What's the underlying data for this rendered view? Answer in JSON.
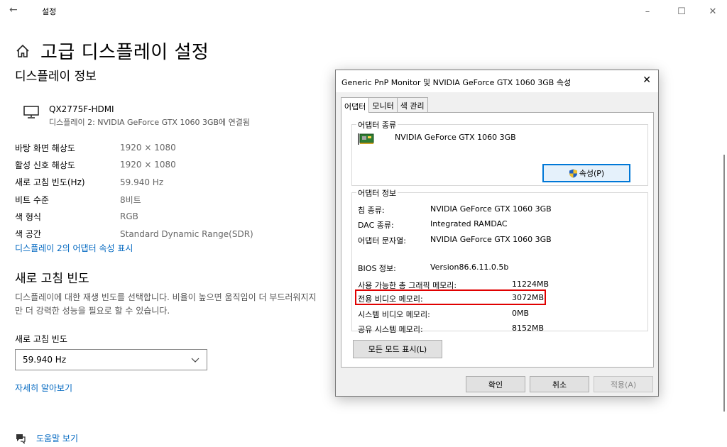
{
  "window": {
    "title": "설정",
    "back_icon": "←",
    "min_icon": "–",
    "max_icon": "☐",
    "close_icon": "✕"
  },
  "page": {
    "title": "고급 디스플레이 설정"
  },
  "display_info": {
    "section_title": "디스플레이 정보",
    "monitor_name": "QX2775F-HDMI",
    "monitor_connection": "디스플레이 2: NVIDIA GeForce GTX 1060 3GB에 연결됨",
    "rows": [
      {
        "label": "바탕 화면 해상도",
        "value": "1920 × 1080"
      },
      {
        "label": "활성 신호 해상도",
        "value": "1920 × 1080"
      },
      {
        "label": "새로 고침 빈도(Hz)",
        "value": "59.940 Hz"
      },
      {
        "label": "비트 수준",
        "value": "8비트"
      },
      {
        "label": "색 형식",
        "value": "RGB"
      },
      {
        "label": "색 공간",
        "value": "Standard Dynamic Range(SDR)"
      }
    ],
    "adapter_link": "디스플레이 2의 어댑터 속성 표시"
  },
  "refresh": {
    "section_title": "새로 고침 빈도",
    "description": "디스플레이에 대한 재생 빈도를 선택합니다. 비율이 높으면 움직임이 더 부드러워지지만 더 강력한 성능을 필요로 할 수 있습니다.",
    "select_label": "새로 고침 빈도",
    "select_value": "59.940 Hz",
    "more_link": "자세히 알아보기"
  },
  "help": {
    "label": "도움말 보기"
  },
  "dialog": {
    "title": "Generic PnP Monitor 및 NVIDIA GeForce GTX 1060 3GB 속성",
    "close_icon": "✕",
    "tabs": [
      {
        "label": "어댑터"
      },
      {
        "label": "모니터"
      },
      {
        "label": "색 관리"
      }
    ],
    "adapter_type_legend": "어댑터 종류",
    "adapter_name": "NVIDIA GeForce GTX 1060 3GB",
    "properties_button": "속성(P)",
    "adapter_info_legend": "어댑터 정보",
    "info_rows": [
      {
        "label": "칩 종류:",
        "value": "NVIDIA GeForce GTX 1060 3GB"
      },
      {
        "label": "DAC 종류:",
        "value": "Integrated RAMDAC"
      },
      {
        "label": "어댑터 문자열:",
        "value": "NVIDIA GeForce GTX 1060 3GB"
      },
      {
        "label": "BIOS 정보:",
        "value": "Version86.6.11.0.5b"
      }
    ],
    "memory_rows": [
      {
        "label": "사용 가능한 총 그래픽 메모리:",
        "value": "11224MB"
      },
      {
        "label": "전용 비디오 메모리:",
        "value": "3072MB"
      },
      {
        "label": "시스템 비디오 메모리:",
        "value": "0MB"
      },
      {
        "label": "공유 시스템 메모리:",
        "value": "8152MB"
      }
    ],
    "all_modes_button": "모든 모드 표시(L)",
    "ok_button": "확인",
    "cancel_button": "취소",
    "apply_button": "적용(A)",
    "highlight_color": "#e00000"
  }
}
